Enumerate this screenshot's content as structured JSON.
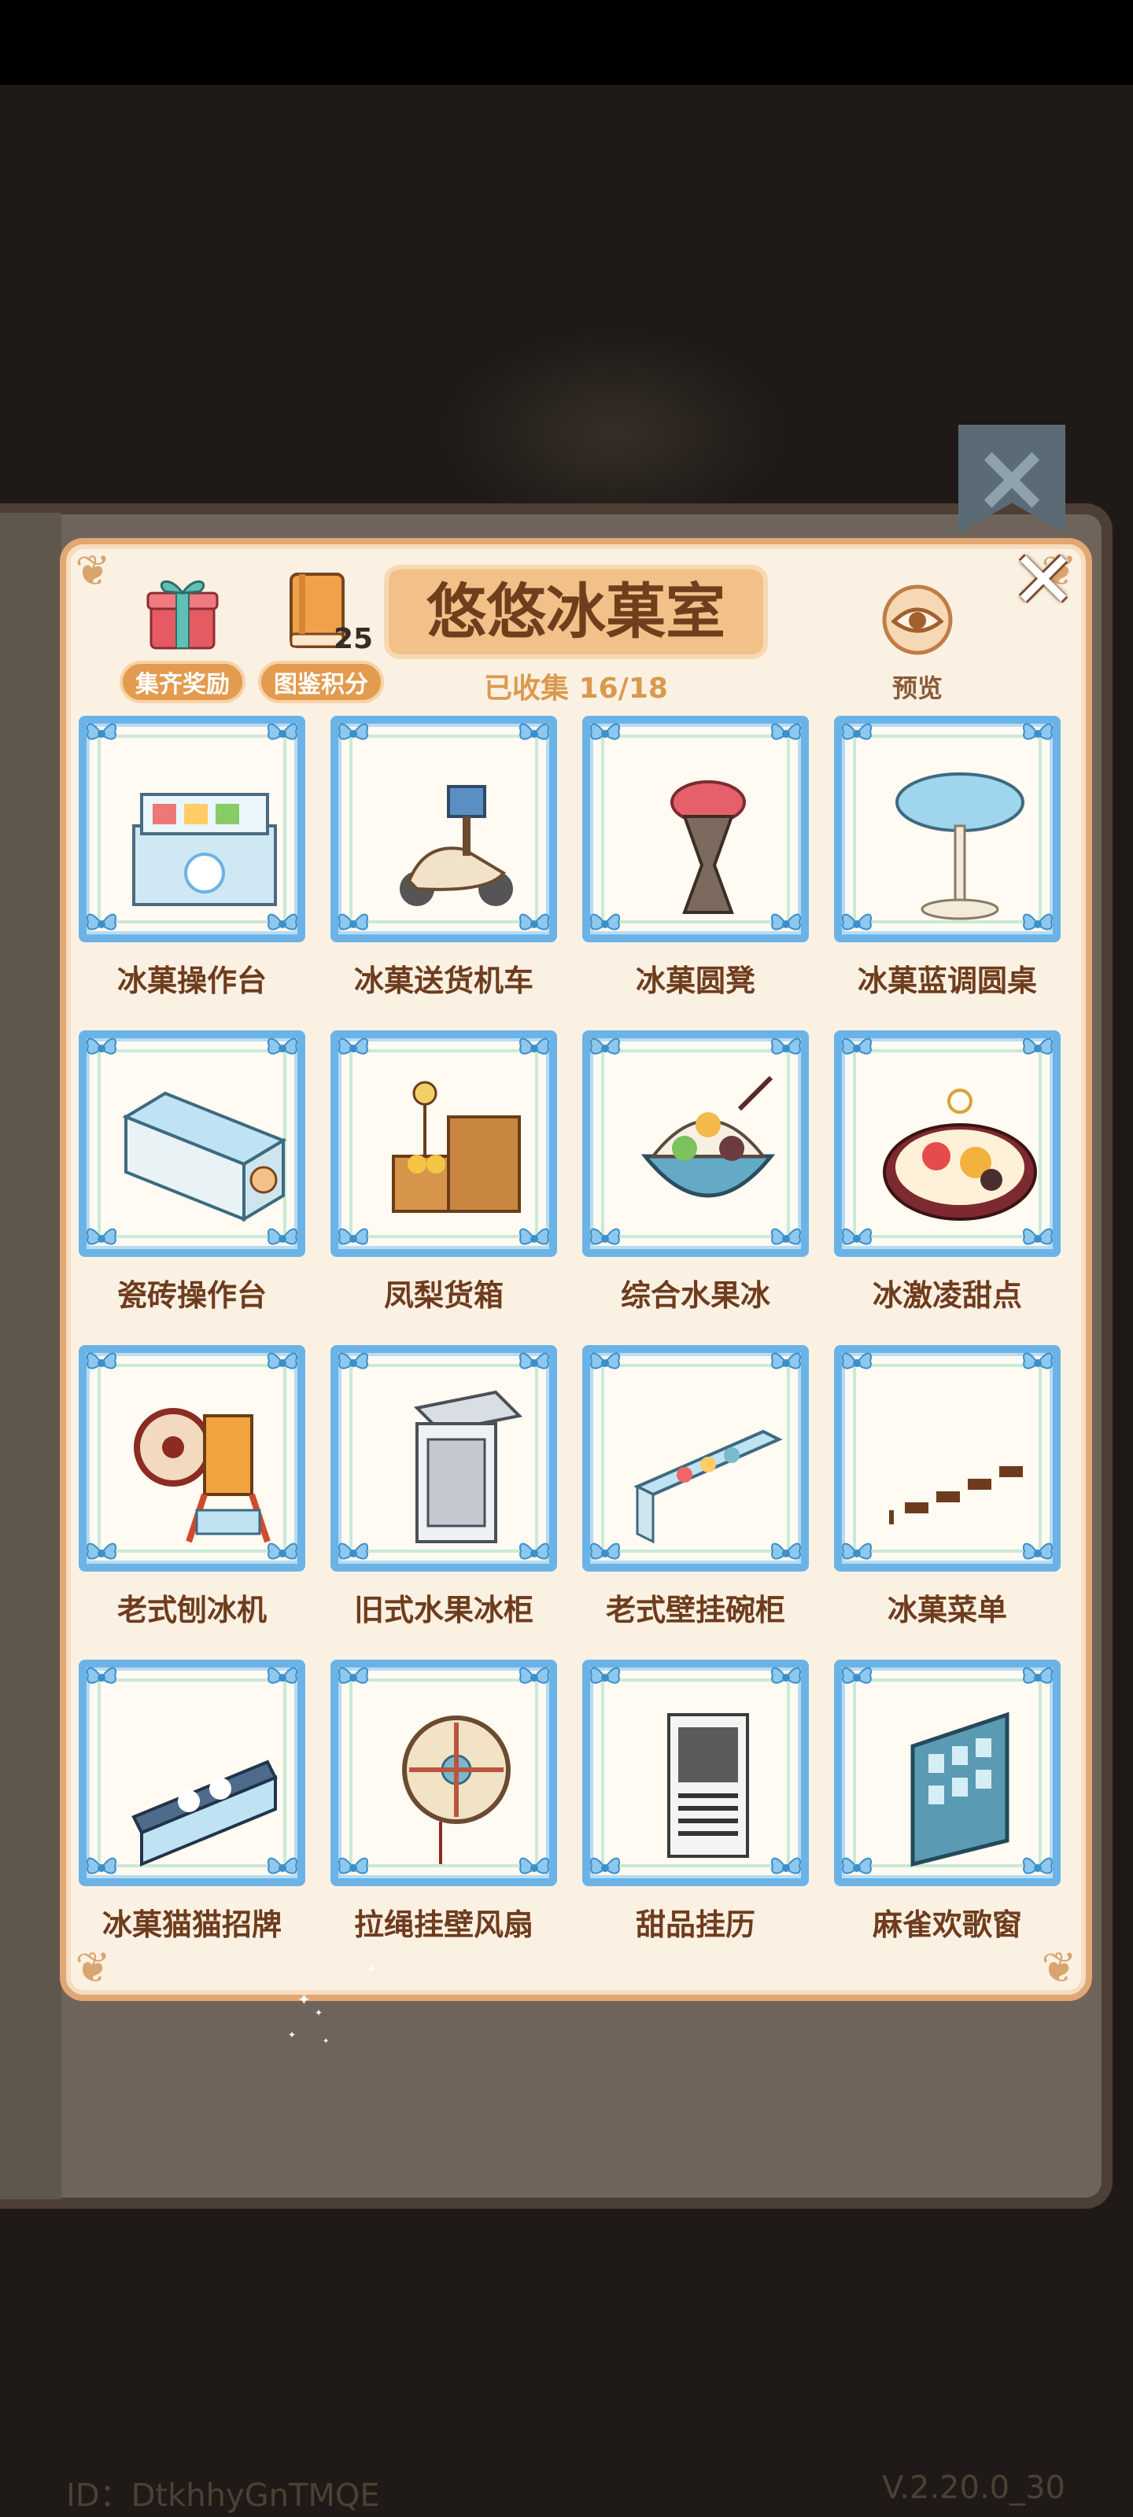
{
  "header": {
    "title": "悠悠冰菓室",
    "collect_text": "已收集 16/18",
    "reward_label": "集齐奖励",
    "score_label": "图鉴积分",
    "score_count": "25",
    "preview_label": "预览"
  },
  "items": [
    {
      "label": "冰菓操作台",
      "icon": "ice-counter-icon"
    },
    {
      "label": "冰菓送货机车",
      "icon": "delivery-scooter-icon"
    },
    {
      "label": "冰菓圆凳",
      "icon": "round-stool-icon"
    },
    {
      "label": "冰菓蓝调圆桌",
      "icon": "blue-round-table-icon"
    },
    {
      "label": "瓷砖操作台",
      "icon": "tile-counter-icon"
    },
    {
      "label": "凤梨货箱",
      "icon": "pineapple-crate-icon"
    },
    {
      "label": "综合水果冰",
      "icon": "fruit-shaved-ice-icon"
    },
    {
      "label": "冰激凌甜点",
      "icon": "ice-cream-dessert-icon"
    },
    {
      "label": "老式刨冰机",
      "icon": "shaved-ice-machine-icon"
    },
    {
      "label": "旧式水果冰柜",
      "icon": "fruit-fridge-icon"
    },
    {
      "label": "老式壁挂碗柜",
      "icon": "wall-cupboard-icon"
    },
    {
      "label": "冰菓菜单",
      "icon": "menu-strip-icon"
    },
    {
      "label": "冰菓猫猫招牌",
      "icon": "cat-signboard-icon"
    },
    {
      "label": "拉绳挂壁风扇",
      "icon": "wall-fan-icon"
    },
    {
      "label": "甜品挂历",
      "icon": "dessert-calendar-icon"
    },
    {
      "label": "麻雀欢歌窗",
      "icon": "sparrow-window-icon"
    }
  ],
  "footer": {
    "id_text": "ID：DtkhhyGnTMQE",
    "version": "V.2.20.0_30"
  },
  "colors": {
    "frame_blue": "#6bb3e6",
    "panel_cream": "#fbf1e3",
    "title_plate": "#f2c189",
    "label_brown": "#6e3c1d",
    "pill_orange": "#e39b4f"
  }
}
